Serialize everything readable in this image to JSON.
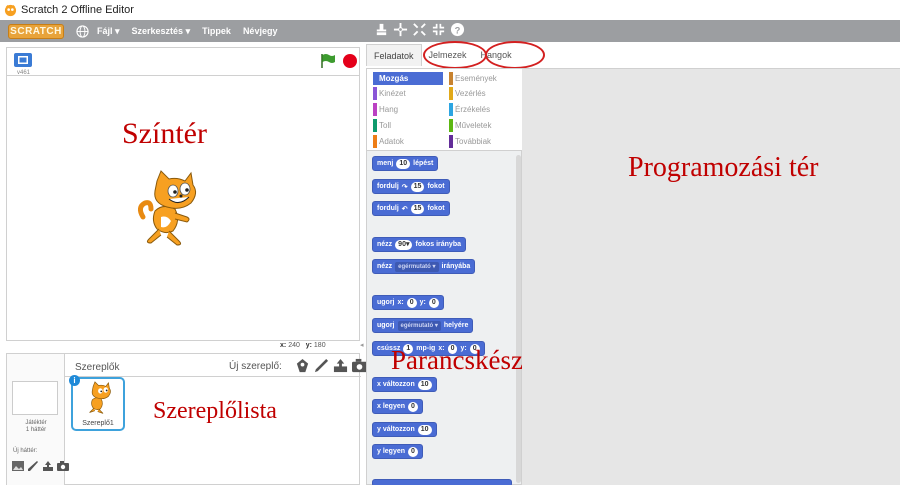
{
  "window": {
    "title": "Scratch 2 Offline Editor"
  },
  "menubar": {
    "logo": "SCRATCH",
    "items": [
      "Fájl ▾",
      "Szerkesztés ▾",
      "Tippek",
      "Névjegy"
    ]
  },
  "stage": {
    "version": "v461",
    "annotation": "Színtér",
    "coords": {
      "x_label": "x:",
      "x_value": "240",
      "y_label": "y:",
      "y_value": "180"
    }
  },
  "sprites": {
    "title": "Szereplők",
    "new_sprite_label": "Új szereplő:",
    "stage_thumb_label": "Játéktér",
    "stage_thumb_sub": "1 háttér",
    "new_backdrop_label": "Új háttér:",
    "selected_sprite": "Szereplő1",
    "annotation": "Szereplőlista"
  },
  "tabs": [
    "Feladatok",
    "Jelmezek",
    "Hangok"
  ],
  "categories": {
    "left": [
      {
        "label": "Mozgás",
        "color": "#4a6cd4",
        "selected": true
      },
      {
        "label": "Kinézet",
        "color": "#8a55d7"
      },
      {
        "label": "Hang",
        "color": "#bb42c3"
      },
      {
        "label": "Toll",
        "color": "#0e9a6c"
      },
      {
        "label": "Adatok",
        "color": "#ee7d16"
      }
    ],
    "right": [
      {
        "label": "Események",
        "color": "#c88330"
      },
      {
        "label": "Vezérlés",
        "color": "#e1a91a"
      },
      {
        "label": "Érzékelés",
        "color": "#2ca5e2"
      },
      {
        "label": "Műveletek",
        "color": "#5cb712"
      },
      {
        "label": "Továbbiak",
        "color": "#632d99"
      }
    ]
  },
  "blocks": {
    "move": {
      "pre": "menj",
      "val": "10",
      "post": "lépést"
    },
    "turn_right": {
      "pre": "fordulj",
      "arrow": "↷",
      "val": "15",
      "post": "fokot"
    },
    "turn_left": {
      "pre": "fordulj",
      "arrow": "↶",
      "val": "15",
      "post": "fokot"
    },
    "point_dir": {
      "pre": "nézz",
      "val": "90▾",
      "post": "fokos irányba"
    },
    "point_towards": {
      "pre": "nézz",
      "dropdown": "egérmutató ▾",
      "post": "irányába"
    },
    "goto_xy": {
      "pre": "ugorj",
      "x_label": "x:",
      "x": "0",
      "y_label": "y:",
      "y": "0"
    },
    "goto": {
      "pre": "ugorj",
      "dropdown": "egérmutató ▾",
      "post": "helyére"
    },
    "glide": {
      "pre": "csússz",
      "secs": "1",
      "mid": "mp-ig",
      "x_label": "x:",
      "x": "0",
      "y_label": "y:",
      "y": "0"
    },
    "change_x": {
      "pre": "x változzon",
      "val": "10"
    },
    "set_x": {
      "pre": "x legyen",
      "val": "0"
    },
    "change_y": {
      "pre": "y változzon",
      "val": "10"
    },
    "set_y": {
      "pre": "y legyen",
      "val": "0"
    }
  },
  "palette_annotation": "Parancskészlet",
  "scripts_annotation": "Programozási tér",
  "colors": {
    "motion": "#4a6cd4",
    "annotation": "#c00000",
    "menubar": "#9c9ea1"
  }
}
